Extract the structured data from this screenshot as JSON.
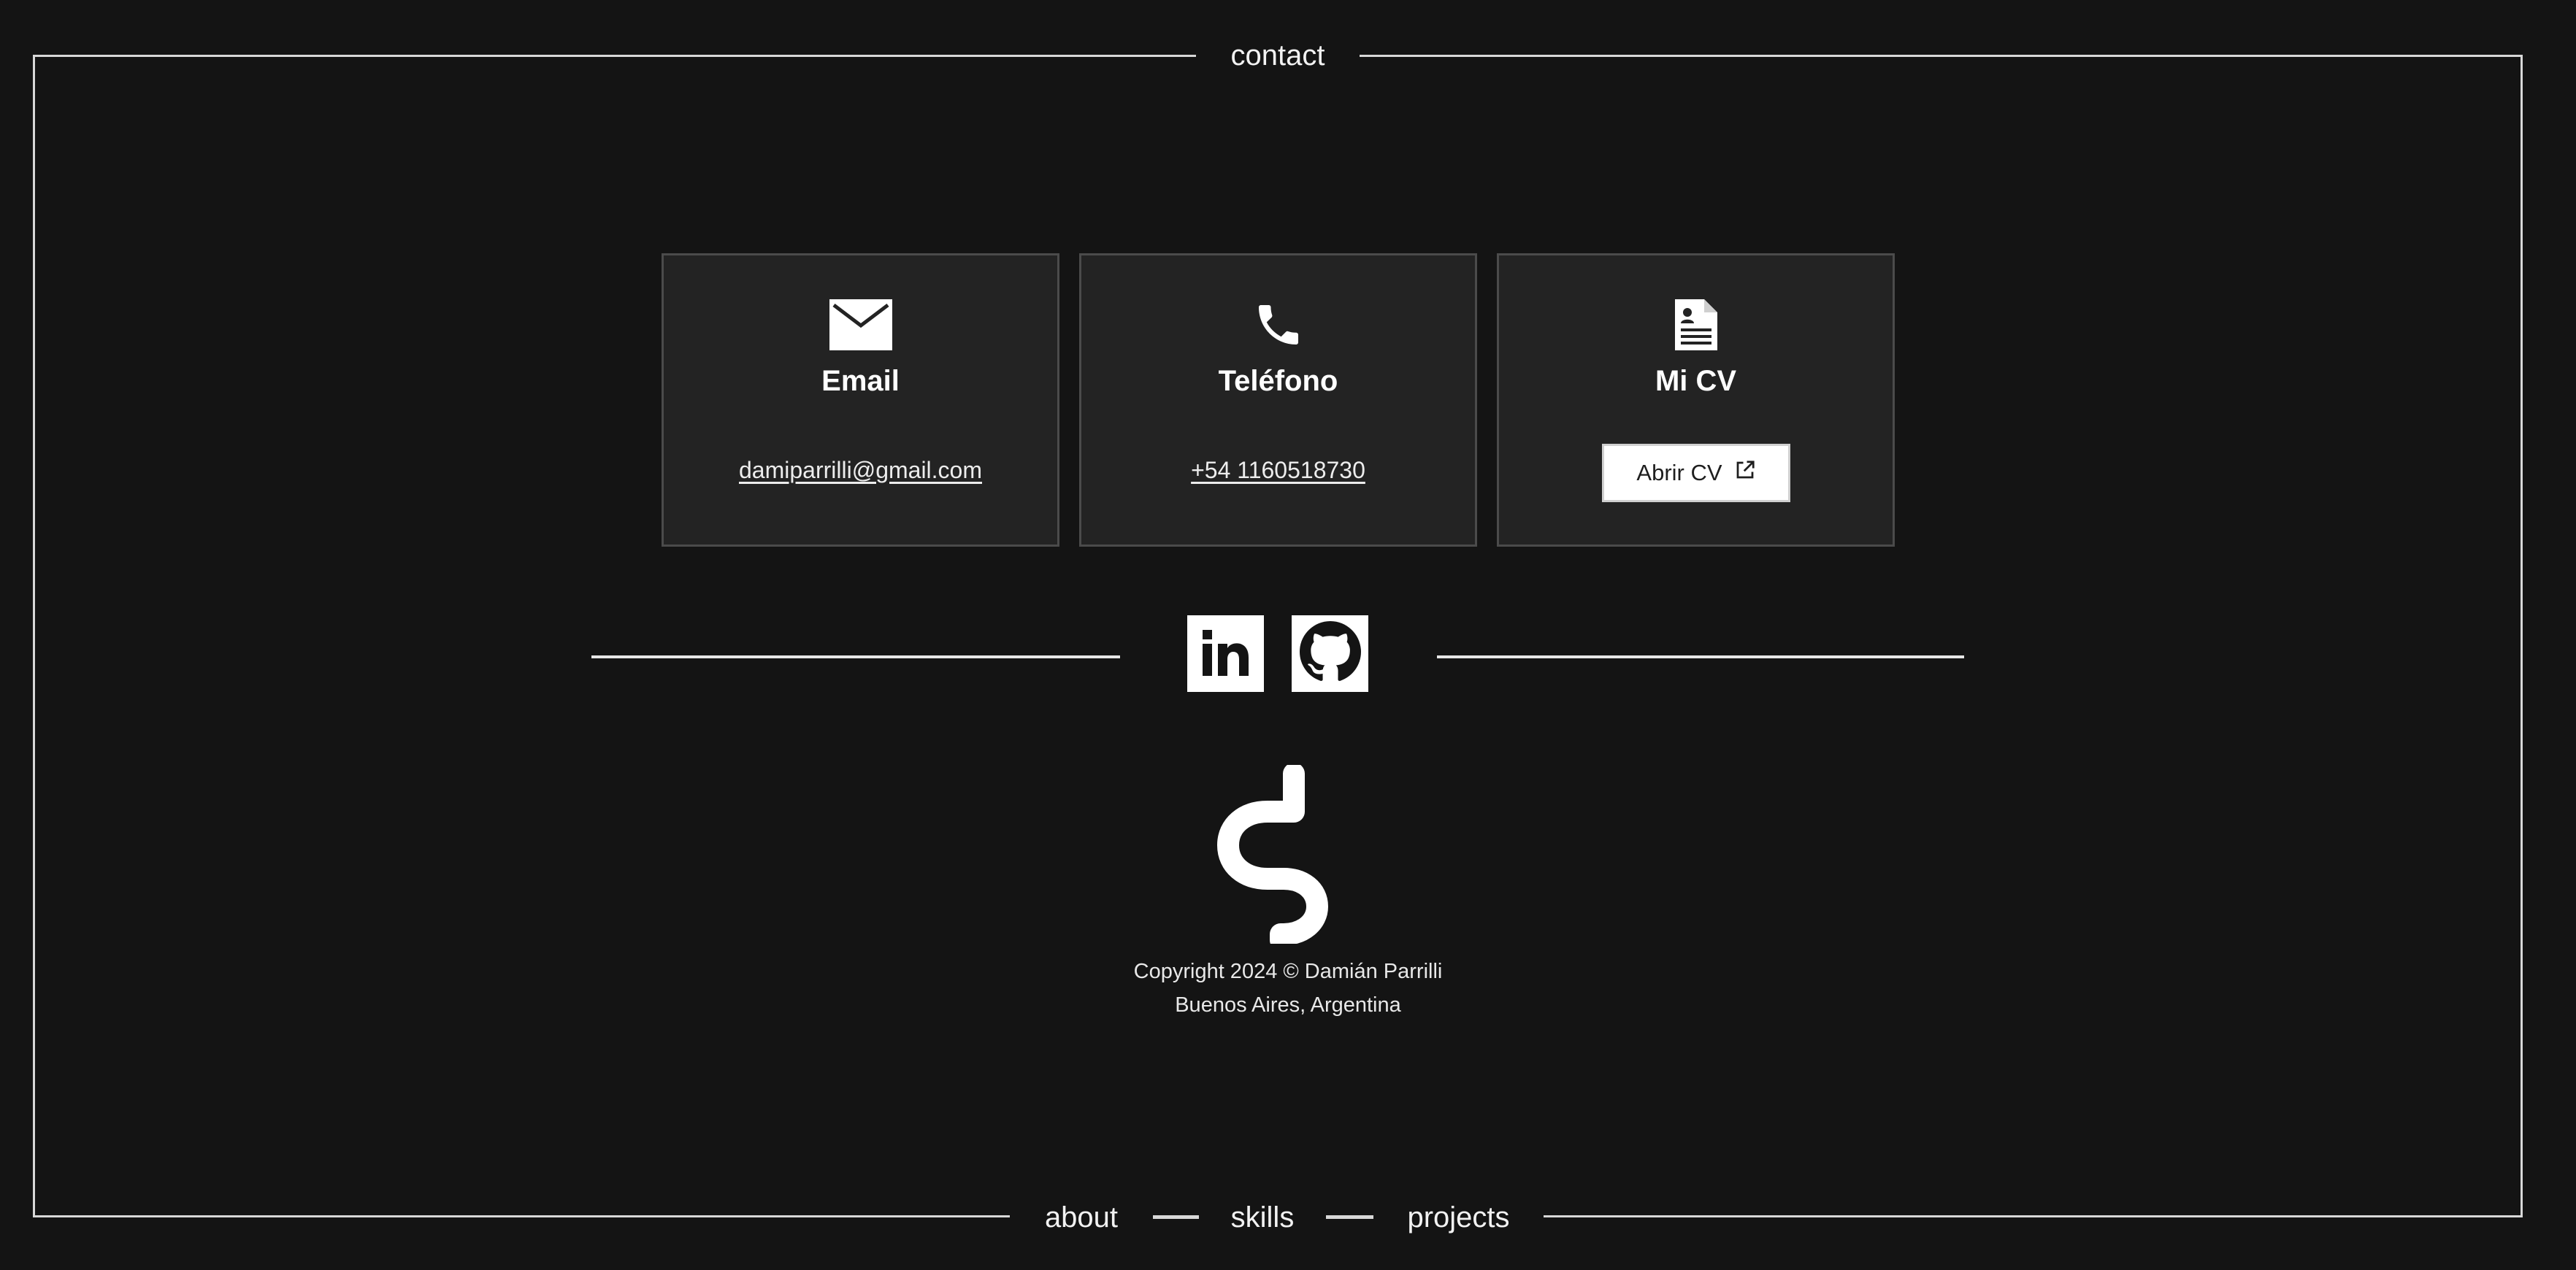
{
  "nav": {
    "top": "contact",
    "bottom": [
      "about",
      "skills",
      "projects"
    ]
  },
  "cards": {
    "email": {
      "title": "Email",
      "value": "damiparrilli@gmail.com",
      "icon": "envelope-icon"
    },
    "phone": {
      "title": "Teléfono",
      "value": "+54 1160518730",
      "icon": "phone-icon"
    },
    "cv": {
      "title": "Mi CV",
      "button_label": "Abrir CV",
      "icon": "resume-icon",
      "button_icon": "external-link-icon"
    }
  },
  "social": [
    {
      "name": "LinkedIn",
      "icon": "linkedin-icon"
    },
    {
      "name": "GitHub",
      "icon": "github-icon"
    }
  ],
  "footer": {
    "copyright": "Copyright 2024 © Damián Parrilli",
    "location": "Buenos Aires, Argentina"
  },
  "colors": {
    "background": "#141414",
    "card_background": "#232323",
    "card_border": "#4b4b4b",
    "line": "#d8d8d8",
    "text": "#f2f2f2",
    "button_background": "#ffffff"
  }
}
